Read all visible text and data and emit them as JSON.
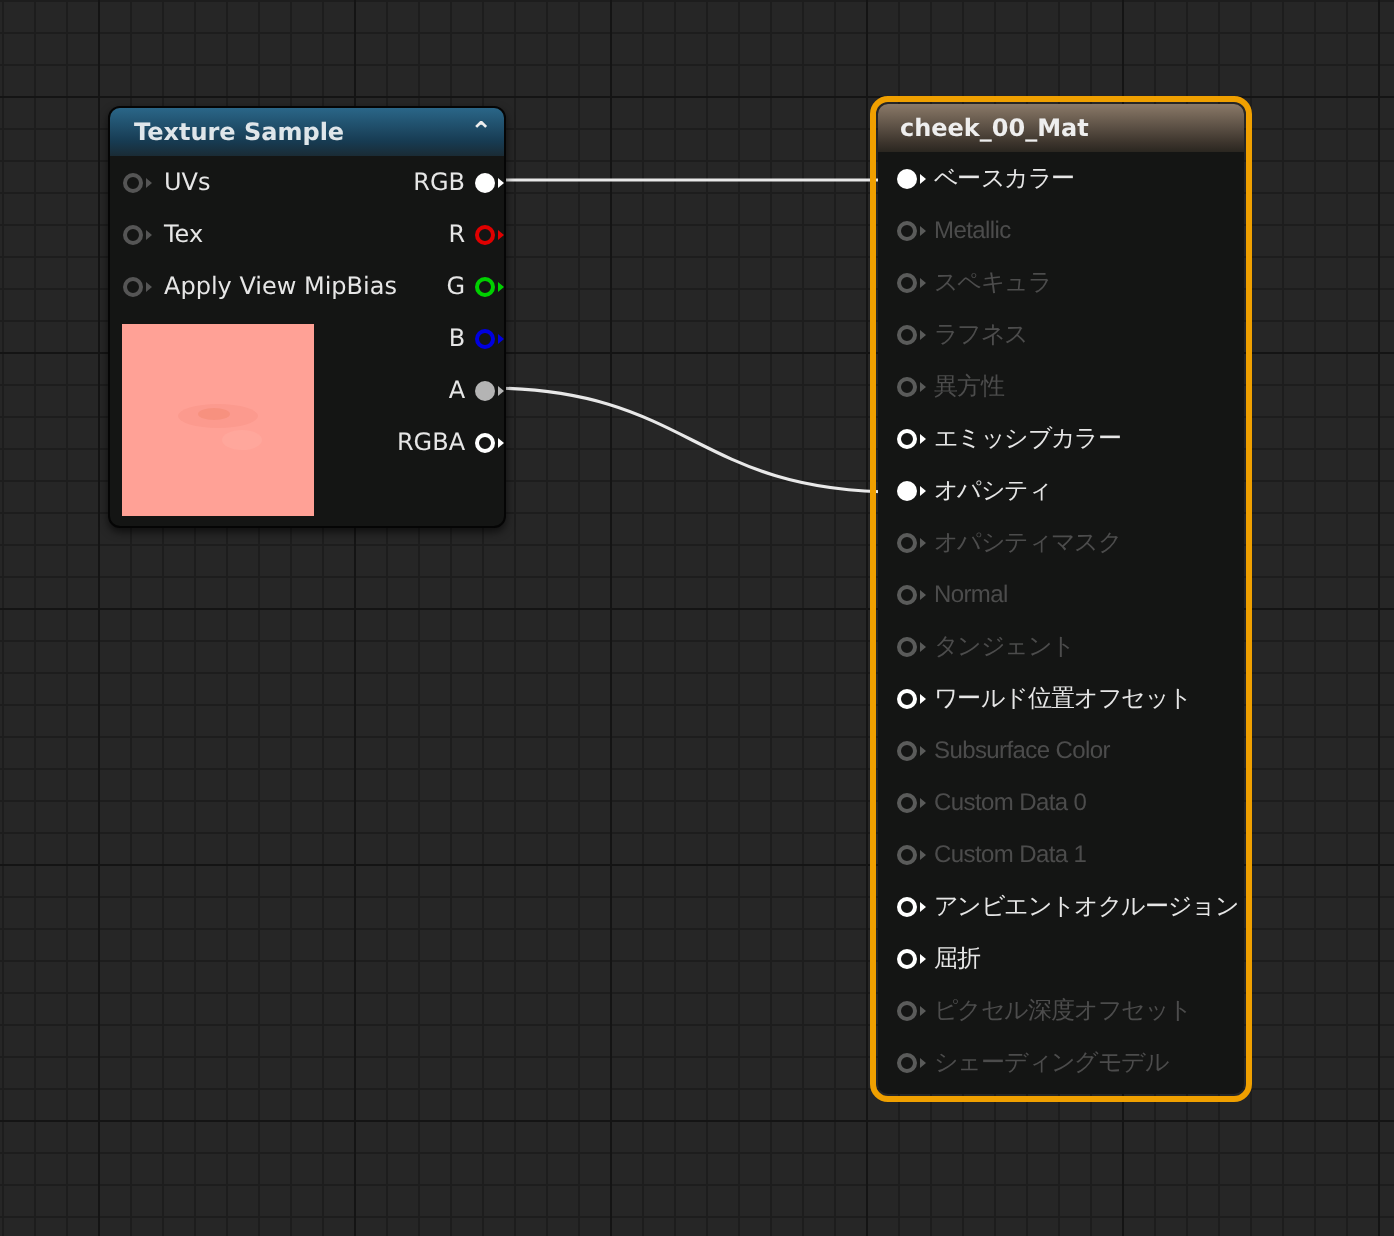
{
  "texture_node": {
    "title": "Texture Sample",
    "collapse_glyph": "⌃",
    "inputs": [
      {
        "label": "UVs",
        "connected": false
      },
      {
        "label": "Tex",
        "connected": false
      },
      {
        "label": "Apply View MipBias",
        "connected": false
      }
    ],
    "outputs": [
      {
        "label": "RGB",
        "color": "#ffffff",
        "connected": true
      },
      {
        "label": "R",
        "color": "#e00000",
        "connected": false
      },
      {
        "label": "G",
        "color": "#00d000",
        "connected": false
      },
      {
        "label": "B",
        "color": "#0000e0",
        "connected": false
      },
      {
        "label": "A",
        "color": "#b4b4b4",
        "connected": true
      },
      {
        "label": "RGBA",
        "color": "#ffffff",
        "connected": false
      }
    ]
  },
  "material_node": {
    "title": "cheek_00_Mat",
    "selected": true,
    "inputs": [
      {
        "label": "ベースカラー",
        "enabled": true,
        "connected": true
      },
      {
        "label": "Metallic",
        "enabled": false,
        "connected": false
      },
      {
        "label": "スペキュラ",
        "enabled": false,
        "connected": false
      },
      {
        "label": "ラフネス",
        "enabled": false,
        "connected": false
      },
      {
        "label": "異方性",
        "enabled": false,
        "connected": false
      },
      {
        "label": "エミッシブカラー",
        "enabled": true,
        "connected": false
      },
      {
        "label": "オパシティ",
        "enabled": true,
        "connected": true
      },
      {
        "label": "オパシティマスク",
        "enabled": false,
        "connected": false
      },
      {
        "label": "Normal",
        "enabled": false,
        "connected": false
      },
      {
        "label": "タンジェント",
        "enabled": false,
        "connected": false
      },
      {
        "label": "ワールド位置オフセット",
        "enabled": true,
        "connected": false
      },
      {
        "label": "Subsurface Color",
        "enabled": false,
        "connected": false
      },
      {
        "label": "Custom Data 0",
        "enabled": false,
        "connected": false
      },
      {
        "label": "Custom Data 1",
        "enabled": false,
        "connected": false
      },
      {
        "label": "アンビエントオクルージョン",
        "enabled": true,
        "connected": false
      },
      {
        "label": "屈折",
        "enabled": true,
        "connected": false
      },
      {
        "label": "ピクセル深度オフセット",
        "enabled": false,
        "connected": false
      },
      {
        "label": "シェーディングモデル",
        "enabled": false,
        "connected": false
      }
    ]
  }
}
